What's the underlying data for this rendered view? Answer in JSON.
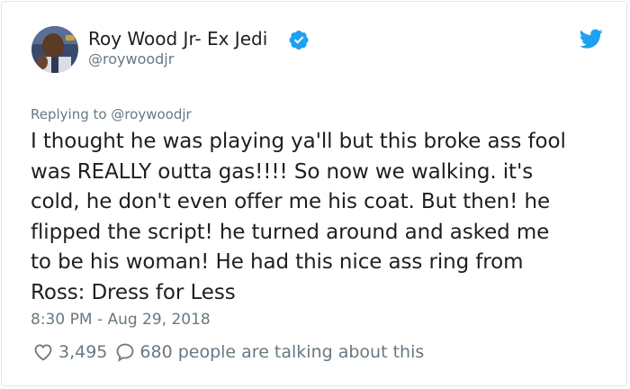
{
  "author": {
    "display_name": "Roy Wood Jr- Ex Jedi",
    "handle": "@roywoodjr",
    "verified_icon": "verified-badge-icon",
    "avatar": "avatar"
  },
  "brand": {
    "logo_icon": "twitter-bird-icon",
    "accent_color": "#1da1f2"
  },
  "tweet": {
    "replying_to": "Replying to @roywoodjr",
    "lines": [
      "I thought he was playing ya'll but this broke ass fool",
      "was REALLY outta gas!!!! So now we walking. it's",
      "cold, he don't even offer me his coat. But then! he",
      "flipped the script! he turned around and asked me",
      "to be his woman! He had this nice ass ring from",
      "Ross: Dress for Less"
    ],
    "timestamp": "8:30 PM - Aug 29, 2018"
  },
  "engagement": {
    "likes": "3,495",
    "talking": "680 people are talking about this",
    "heart_icon": "heart-icon",
    "reply_icon": "speech-bubble-icon"
  }
}
